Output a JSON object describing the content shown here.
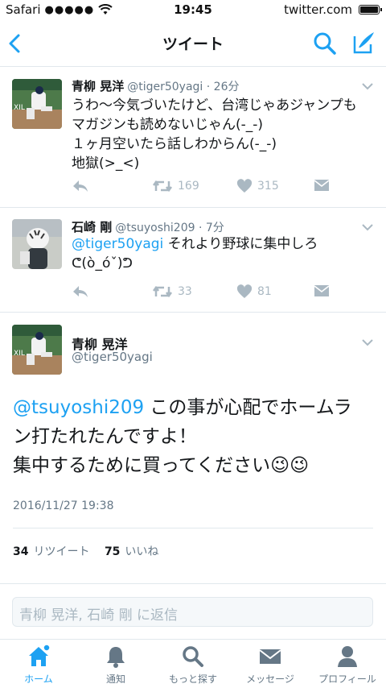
{
  "status_bar": {
    "carrier": "Safari",
    "signal": "●●●●●",
    "time": "19:45",
    "url": "twitter.com"
  },
  "nav": {
    "title": "ツイート"
  },
  "tweets": [
    {
      "name": "青柳 晃洋",
      "handle": "@tiger50yagi · 26分",
      "lines": [
        "うわ〜今気づいたけど、台湾じゃあジャンプも",
        "マガジンも読めないじゃん(-_-)",
        "１ヶ月空いたら話しわからん(-_-)",
        "地獄(>_<)"
      ],
      "retweets": "169",
      "likes": "315"
    },
    {
      "name": "石崎 剛",
      "handle": "@tsuyoshi209 · 7分",
      "mention": "@tiger50yagi",
      "text1": " それより野球に集中しろ",
      "text2": "ᕦ(ò_óˇ)ᕤ",
      "retweets": "33",
      "likes": "81"
    }
  ],
  "detail": {
    "name": "青柳 晃洋",
    "handle": "@tiger50yagi",
    "mention": "@tsuyoshi209",
    "text1": " この事が心配でホームラ",
    "text2": "ン打たれたんですよ！",
    "text3": "集中するために買ってください😉😉",
    "date": "2016/11/27 19:38",
    "retweet_count": "34",
    "retweet_label": "リツイート",
    "like_count": "75",
    "like_label": "いいね"
  },
  "reply": {
    "placeholder": "青柳 晃洋, 石崎 剛 に返信"
  },
  "tabs": [
    {
      "label": "ホーム",
      "icon": "home-icon"
    },
    {
      "label": "通知",
      "icon": "bell-icon"
    },
    {
      "label": "もっと探す",
      "icon": "search-icon"
    },
    {
      "label": "メッセージ",
      "icon": "envelope-icon"
    },
    {
      "label": "プロフィール",
      "icon": "person-icon"
    }
  ],
  "colors": {
    "accent": "#1da1f2",
    "muted": "#657786",
    "icon_gray": "#aab8c2"
  }
}
